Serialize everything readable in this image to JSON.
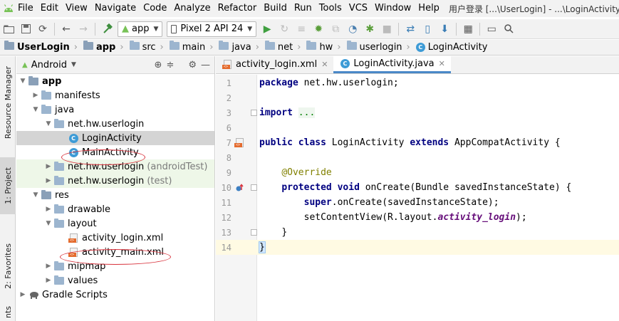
{
  "menu": {
    "items": [
      "File",
      "Edit",
      "View",
      "Navigate",
      "Code",
      "Analyze",
      "Refactor",
      "Build",
      "Run",
      "Tools",
      "VCS",
      "Window",
      "Help"
    ],
    "window_title": "用户登录 [...\\UserLogin] - ...\\LoginActivity.java"
  },
  "toolbar": {
    "config": "app",
    "device": "Pixel 2 API 24"
  },
  "breadcrumb": [
    "UserLogin",
    "app",
    "src",
    "main",
    "java",
    "net",
    "hw",
    "userlogin",
    "LoginActivity"
  ],
  "stripe": {
    "resource_manager": "Resource Manager",
    "project": "1: Project",
    "favorites": "2: Favorites",
    "structure": "nts"
  },
  "project_panel": {
    "view": "Android",
    "tree": [
      {
        "label": "app",
        "bold": true
      },
      {
        "label": "manifests"
      },
      {
        "label": "java"
      },
      {
        "label": "net.hw.userlogin"
      },
      {
        "label": "LoginActivity",
        "selected": true
      },
      {
        "label": "MainActivity"
      },
      {
        "label": "net.hw.userlogin",
        "suffix": "(androidTest)"
      },
      {
        "label": "net.hw.userlogin",
        "suffix": "(test)"
      },
      {
        "label": "res"
      },
      {
        "label": "drawable"
      },
      {
        "label": "layout"
      },
      {
        "label": "activity_login.xml"
      },
      {
        "label": "activity_main.xml"
      },
      {
        "label": "mipmap"
      },
      {
        "label": "values"
      },
      {
        "label": "Gradle Scripts"
      }
    ]
  },
  "editor": {
    "tabs": [
      {
        "label": "activity_login.xml",
        "active": false
      },
      {
        "label": "LoginActivity.java",
        "active": true
      }
    ],
    "line_numbers": [
      "1",
      "2",
      "3",
      "6",
      "7",
      "8",
      "9",
      "10",
      "11",
      "12",
      "13",
      "14"
    ],
    "code": {
      "l1_kw": "package",
      "l1_rest": " net.hw.userlogin;",
      "l3_kw": "import",
      "l3_fold": "...",
      "l7_kw1": "public",
      "l7_kw2": "class",
      "l7_name": " LoginActivity ",
      "l7_kw3": "extends",
      "l7_rest": " AppCompatActivity ",
      "l7_brace": "{",
      "l9_ann": "@Override",
      "l10_kw1": "protected",
      "l10_kw2": "void",
      "l10_rest": " onCreate(Bundle savedInstanceState) {",
      "l11_kw": "super",
      "l11_rest": ".onCreate(savedInstanceState);",
      "l12_pre": "setContentView(R.layout.",
      "l12_ital": "activity_login",
      "l12_post": ");",
      "l13": "}",
      "l14": "}"
    }
  }
}
